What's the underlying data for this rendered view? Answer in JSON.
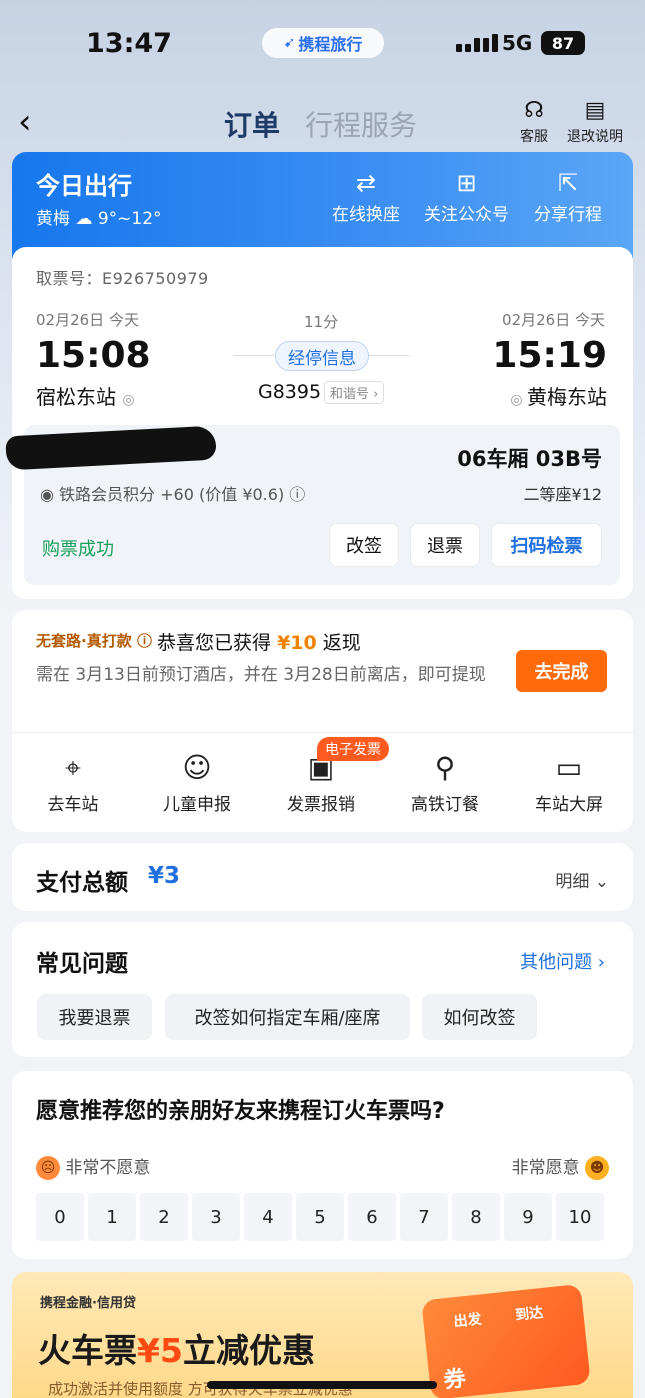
{
  "status_bar": {
    "time": "13:47",
    "brand": "携程旅行",
    "network": "5G",
    "battery": "87"
  },
  "nav": {
    "tabs": [
      "订单",
      "行程服务"
    ],
    "actions": [
      {
        "label": "客服",
        "icon": "headset-icon"
      },
      {
        "label": "退改说明",
        "icon": "document-icon"
      }
    ]
  },
  "today": {
    "title": "今日出行",
    "city": "黄梅",
    "weather": "9°~12°",
    "actions": [
      {
        "label": "在线换座",
        "icon": "seat-swap-icon"
      },
      {
        "label": "关注公众号",
        "icon": "follow-icon"
      },
      {
        "label": "分享行程",
        "icon": "share-icon"
      }
    ]
  },
  "ticket": {
    "pickup": "取票号：E926750979",
    "depart_date": "02月26日  今天",
    "arrive_date": "02月26日  今天",
    "duration": "11分",
    "depart_time": "15:08",
    "arrive_time": "15:19",
    "stops_label": "经停信息",
    "depart_station": "宿松东站",
    "arrive_station": "黄梅东站",
    "train_no": "G8395",
    "train_brand": "和谐号 ›",
    "seat": "06车厢 03B号",
    "points": "铁路会员积分 +60 (价值 ¥0.6)",
    "seat_class": "二等座¥12",
    "status": "购票成功",
    "buttons": [
      "改签",
      "退票",
      "扫码检票"
    ]
  },
  "cashback": {
    "tag": "无套路·真打款",
    "title_pre": "恭喜您已获得",
    "amount": "¥10",
    "title_post": "返现",
    "desc": "需在 3月13日前预订酒店，并在 3月28日前离店，即可提现",
    "button": "去完成",
    "badge": "电子发票",
    "services": [
      {
        "label": "去车站",
        "icon": "location-pin-icon"
      },
      {
        "label": "儿童申报",
        "icon": "child-face-icon"
      },
      {
        "label": "发票报销",
        "icon": "invoice-icon"
      },
      {
        "label": "高铁订餐",
        "icon": "dining-icon"
      },
      {
        "label": "车站大屏",
        "icon": "screen-icon"
      }
    ]
  },
  "pay": {
    "label": "支付总额",
    "amount": "¥3",
    "detail": "明细 ⌄"
  },
  "faq": {
    "title": "常见问题",
    "more": "其他问题 ›",
    "chips": [
      "我要退票",
      "改签如何指定车厢/座席",
      "如何改签"
    ]
  },
  "nps": {
    "title": "愿意推荐您的亲朋好友来携程订火车票吗?",
    "low": "非常不愿意",
    "high": "非常愿意",
    "scores": [
      "0",
      "1",
      "2",
      "3",
      "4",
      "5",
      "6",
      "7",
      "8",
      "9",
      "10"
    ]
  },
  "promo": {
    "brand": "携程金融·信用贷",
    "title_pre": "火车票",
    "title_amount": "¥5",
    "title_post": "立减优惠",
    "desc": "成功激活并使用额度 方可获得火车票立减优惠",
    "art_from": "出发",
    "art_to": "到达",
    "art_coupon": "券"
  }
}
